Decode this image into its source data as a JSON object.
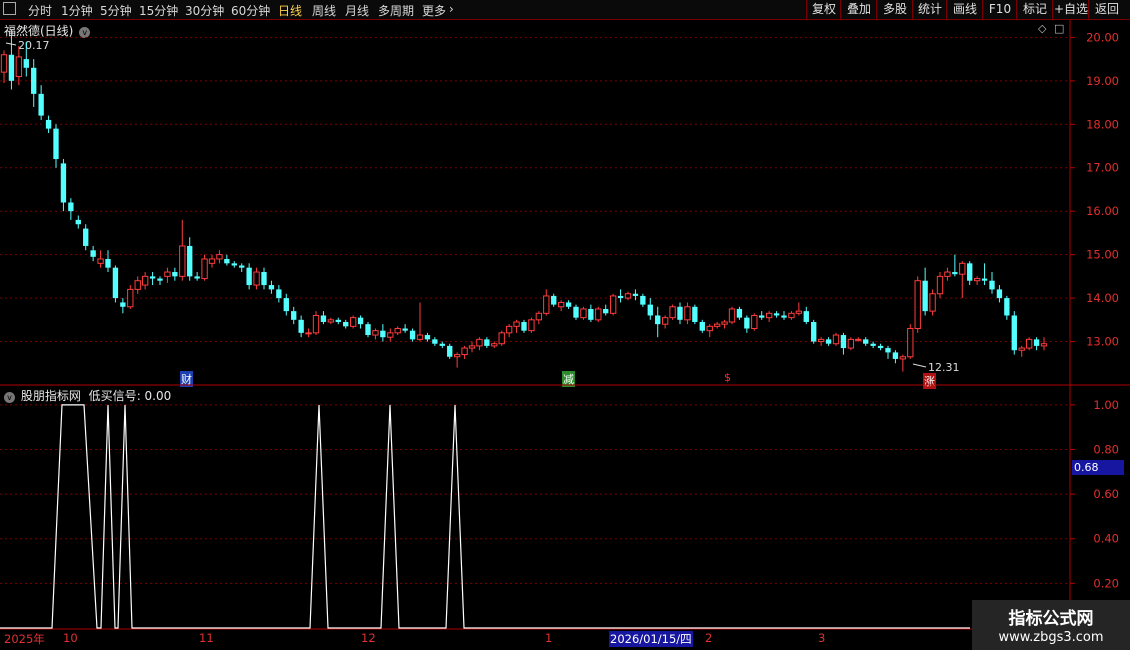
{
  "topbar": {
    "periods": [
      "分时",
      "1分钟",
      "5分钟",
      "15分钟",
      "30分钟",
      "60分钟",
      "日线",
      "周线",
      "月线",
      "多周期",
      "更多"
    ],
    "active": "日线",
    "tools": [
      "复权",
      "叠加",
      "多股",
      "统计",
      "画线",
      "F10",
      "标记",
      "+自选",
      "返回"
    ]
  },
  "main_panel": {
    "title": "福然德(日线)",
    "high_label": "20.17",
    "low_label": "12.31",
    "event_marks": [
      {
        "text": "财",
        "color": "#3b7bff"
      },
      {
        "text": "减",
        "color": "#37c837"
      },
      {
        "text": "$",
        "color": "#ff3030"
      },
      {
        "text": "涨",
        "color": "#ff3030"
      }
    ]
  },
  "indicator_panel": {
    "title": "股朋指标网",
    "signal_name": "低买信号",
    "signal_value": "0.00",
    "current_readout": "0.68"
  },
  "x_axis": {
    "labels": [
      "2025年",
      "10",
      "11",
      "12",
      "1",
      "2026/01/15/四",
      "2",
      "3"
    ]
  },
  "watermark": {
    "line1": "指标公式网",
    "line2": "www.zbgs3.com"
  },
  "colors": {
    "up": "#ff3c3c",
    "down": "#54ffff",
    "grid": "#7a0000",
    "axis": "#b00000",
    "signal": "#ffffff"
  },
  "chart_data": [
    {
      "type": "candlestick",
      "title": "福然德(日线)",
      "ylim": [
        12.0,
        20.4
      ],
      "yticks": [
        "20.00",
        "19.00",
        "18.00",
        "17.00",
        "16.00",
        "15.00",
        "14.00",
        "13.00"
      ],
      "candles": [
        [
          19.2,
          19.7,
          18.95,
          19.6
        ],
        [
          19.6,
          20.17,
          18.8,
          19.0
        ],
        [
          19.1,
          19.8,
          18.9,
          19.55
        ],
        [
          19.5,
          19.9,
          19.1,
          19.3
        ],
        [
          19.3,
          19.5,
          18.4,
          18.7
        ],
        [
          18.7,
          18.9,
          18.1,
          18.2
        ],
        [
          18.1,
          18.2,
          17.8,
          17.9
        ],
        [
          17.9,
          18.0,
          17.0,
          17.2
        ],
        [
          17.1,
          17.2,
          16.0,
          16.2
        ],
        [
          16.2,
          16.3,
          15.8,
          16.0
        ],
        [
          15.8,
          15.9,
          15.6,
          15.7
        ],
        [
          15.6,
          15.7,
          15.1,
          15.2
        ],
        [
          15.1,
          15.2,
          14.85,
          14.95
        ],
        [
          14.8,
          15.1,
          14.7,
          14.9
        ],
        [
          14.9,
          15.1,
          14.6,
          14.7
        ],
        [
          14.7,
          14.75,
          13.9,
          14.0
        ],
        [
          13.9,
          14.0,
          13.65,
          13.8
        ],
        [
          13.8,
          14.3,
          13.75,
          14.2
        ],
        [
          14.2,
          14.5,
          14.1,
          14.4
        ],
        [
          14.3,
          14.6,
          14.2,
          14.5
        ],
        [
          14.5,
          14.6,
          14.3,
          14.45
        ],
        [
          14.45,
          14.5,
          14.3,
          14.4
        ],
        [
          14.5,
          14.7,
          14.35,
          14.6
        ],
        [
          14.6,
          14.7,
          14.4,
          14.5
        ],
        [
          14.5,
          15.8,
          14.4,
          15.2
        ],
        [
          15.2,
          15.4,
          14.4,
          14.5
        ],
        [
          14.5,
          14.6,
          14.4,
          14.45
        ],
        [
          14.45,
          15.0,
          14.4,
          14.9
        ],
        [
          14.8,
          15.0,
          14.7,
          14.9
        ],
        [
          14.9,
          15.1,
          14.8,
          15.0
        ],
        [
          14.9,
          15.0,
          14.75,
          14.8
        ],
        [
          14.8,
          14.85,
          14.7,
          14.75
        ],
        [
          14.75,
          14.8,
          14.6,
          14.7
        ],
        [
          14.7,
          14.8,
          14.2,
          14.3
        ],
        [
          14.3,
          14.7,
          14.2,
          14.6
        ],
        [
          14.6,
          14.7,
          14.2,
          14.3
        ],
        [
          14.3,
          14.4,
          14.1,
          14.2
        ],
        [
          14.2,
          14.3,
          13.9,
          14.0
        ],
        [
          14.0,
          14.1,
          13.6,
          13.7
        ],
        [
          13.7,
          13.8,
          13.4,
          13.5
        ],
        [
          13.5,
          13.6,
          13.1,
          13.2
        ],
        [
          13.2,
          13.3,
          13.1,
          13.2
        ],
        [
          13.2,
          13.7,
          13.15,
          13.6
        ],
        [
          13.6,
          13.7,
          13.4,
          13.45
        ],
        [
          13.45,
          13.55,
          13.4,
          13.5
        ],
        [
          13.5,
          13.55,
          13.4,
          13.45
        ],
        [
          13.45,
          13.5,
          13.3,
          13.35
        ],
        [
          13.35,
          13.6,
          13.3,
          13.55
        ],
        [
          13.55,
          13.6,
          13.3,
          13.4
        ],
        [
          13.4,
          13.45,
          13.1,
          13.15
        ],
        [
          13.15,
          13.3,
          13.05,
          13.25
        ],
        [
          13.25,
          13.4,
          13.0,
          13.1
        ],
        [
          13.1,
          13.3,
          13.0,
          13.2
        ],
        [
          13.2,
          13.35,
          13.15,
          13.3
        ],
        [
          13.3,
          13.4,
          13.2,
          13.25
        ],
        [
          13.25,
          13.3,
          13.0,
          13.05
        ],
        [
          13.05,
          13.9,
          13.0,
          13.15
        ],
        [
          13.15,
          13.2,
          13.0,
          13.05
        ],
        [
          13.05,
          13.1,
          12.9,
          12.95
        ],
        [
          12.95,
          13.0,
          12.85,
          12.9
        ],
        [
          12.9,
          12.95,
          12.6,
          12.65
        ],
        [
          12.65,
          12.75,
          12.4,
          12.7
        ],
        [
          12.7,
          12.9,
          12.6,
          12.85
        ],
        [
          12.85,
          13.0,
          12.75,
          12.9
        ],
        [
          12.9,
          13.1,
          12.8,
          13.05
        ],
        [
          13.05,
          13.1,
          12.85,
          12.9
        ],
        [
          12.9,
          13.0,
          12.85,
          12.95
        ],
        [
          12.95,
          13.25,
          12.9,
          13.2
        ],
        [
          13.2,
          13.4,
          13.1,
          13.35
        ],
        [
          13.35,
          13.5,
          13.2,
          13.45
        ],
        [
          13.45,
          13.5,
          13.2,
          13.25
        ],
        [
          13.25,
          13.55,
          13.2,
          13.5
        ],
        [
          13.5,
          13.7,
          13.4,
          13.65
        ],
        [
          13.65,
          14.2,
          13.6,
          14.05
        ],
        [
          14.05,
          14.1,
          13.8,
          13.85
        ],
        [
          13.8,
          13.95,
          13.7,
          13.9
        ],
        [
          13.9,
          13.95,
          13.75,
          13.8
        ],
        [
          13.8,
          13.85,
          13.5,
          13.55
        ],
        [
          13.55,
          13.8,
          13.5,
          13.75
        ],
        [
          13.75,
          13.85,
          13.45,
          13.5
        ],
        [
          13.5,
          13.8,
          13.45,
          13.75
        ],
        [
          13.75,
          13.85,
          13.6,
          13.65
        ],
        [
          13.65,
          14.1,
          13.6,
          14.05
        ],
        [
          14.05,
          14.2,
          13.9,
          14.0
        ],
        [
          14.0,
          14.15,
          13.95,
          14.1
        ],
        [
          14.1,
          14.2,
          13.95,
          14.05
        ],
        [
          14.05,
          14.1,
          13.8,
          13.85
        ],
        [
          13.85,
          14.0,
          13.5,
          13.6
        ],
        [
          13.6,
          13.8,
          13.1,
          13.4
        ],
        [
          13.4,
          13.6,
          13.3,
          13.55
        ],
        [
          13.55,
          13.85,
          13.5,
          13.8
        ],
        [
          13.8,
          13.9,
          13.4,
          13.5
        ],
        [
          13.5,
          13.9,
          13.4,
          13.8
        ],
        [
          13.8,
          13.85,
          13.4,
          13.45
        ],
        [
          13.45,
          13.5,
          13.2,
          13.25
        ],
        [
          13.25,
          13.4,
          13.1,
          13.35
        ],
        [
          13.35,
          13.45,
          13.3,
          13.4
        ],
        [
          13.4,
          13.5,
          13.3,
          13.45
        ],
        [
          13.45,
          13.8,
          13.4,
          13.75
        ],
        [
          13.75,
          13.8,
          13.5,
          13.55
        ],
        [
          13.55,
          13.6,
          13.2,
          13.3
        ],
        [
          13.3,
          13.65,
          13.25,
          13.6
        ],
        [
          13.6,
          13.7,
          13.5,
          13.55
        ],
        [
          13.55,
          13.7,
          13.45,
          13.65
        ],
        [
          13.65,
          13.7,
          13.55,
          13.6
        ],
        [
          13.6,
          13.7,
          13.5,
          13.55
        ],
        [
          13.55,
          13.7,
          13.5,
          13.65
        ],
        [
          13.65,
          13.9,
          13.6,
          13.7
        ],
        [
          13.7,
          13.8,
          13.4,
          13.45
        ],
        [
          13.45,
          13.5,
          12.95,
          13.0
        ],
        [
          13.0,
          13.1,
          12.9,
          13.05
        ],
        [
          13.05,
          13.1,
          12.9,
          12.95
        ],
        [
          12.95,
          13.2,
          12.9,
          13.15
        ],
        [
          13.15,
          13.2,
          12.7,
          12.85
        ],
        [
          12.85,
          13.1,
          12.8,
          13.05
        ],
        [
          13.05,
          13.1,
          13.0,
          13.05
        ],
        [
          13.05,
          13.1,
          12.9,
          12.95
        ],
        [
          12.95,
          13.0,
          12.85,
          12.9
        ],
        [
          12.9,
          12.95,
          12.8,
          12.85
        ],
        [
          12.85,
          12.9,
          12.6,
          12.75
        ],
        [
          12.75,
          12.8,
          12.5,
          12.6
        ],
        [
          12.6,
          12.7,
          12.31,
          12.65
        ],
        [
          12.65,
          13.4,
          12.6,
          13.3
        ],
        [
          13.3,
          14.5,
          13.2,
          14.4
        ],
        [
          14.4,
          14.7,
          13.6,
          13.7
        ],
        [
          13.7,
          14.2,
          13.6,
          14.1
        ],
        [
          14.1,
          14.6,
          14.0,
          14.5
        ],
        [
          14.5,
          14.7,
          14.4,
          14.6
        ],
        [
          14.6,
          15.0,
          14.5,
          14.55
        ],
        [
          14.55,
          14.85,
          14.0,
          14.8
        ],
        [
          14.8,
          14.85,
          14.3,
          14.4
        ],
        [
          14.4,
          14.5,
          14.3,
          14.45
        ],
        [
          14.45,
          14.8,
          14.3,
          14.4
        ],
        [
          14.4,
          14.6,
          14.1,
          14.2
        ],
        [
          14.2,
          14.3,
          13.9,
          14.0
        ],
        [
          14.0,
          14.05,
          13.5,
          13.6
        ],
        [
          13.6,
          13.7,
          12.7,
          12.8
        ],
        [
          12.8,
          12.9,
          12.65,
          12.85
        ],
        [
          12.85,
          13.1,
          12.8,
          13.05
        ],
        [
          13.05,
          13.1,
          12.8,
          12.9
        ],
        [
          12.9,
          13.1,
          12.8,
          12.95
        ]
      ]
    },
    {
      "type": "line",
      "title": "低买信号",
      "ylim": [
        0,
        1.08
      ],
      "yticks": [
        "1.00",
        "0.80",
        "0.60",
        "0.40",
        "0.20"
      ],
      "points": [
        [
          0,
          0
        ],
        [
          52,
          0
        ],
        [
          62,
          1
        ],
        [
          84,
          1
        ],
        [
          97,
          0
        ],
        [
          101,
          0
        ],
        [
          108,
          1
        ],
        [
          115,
          0
        ],
        [
          118,
          0
        ],
        [
          125,
          1
        ],
        [
          132,
          0
        ],
        [
          310,
          0
        ],
        [
          319,
          1
        ],
        [
          328,
          0
        ],
        [
          381,
          0
        ],
        [
          390,
          1
        ],
        [
          399,
          0
        ],
        [
          446,
          0
        ],
        [
          455,
          1
        ],
        [
          464,
          0
        ],
        [
          970,
          0
        ]
      ]
    }
  ]
}
